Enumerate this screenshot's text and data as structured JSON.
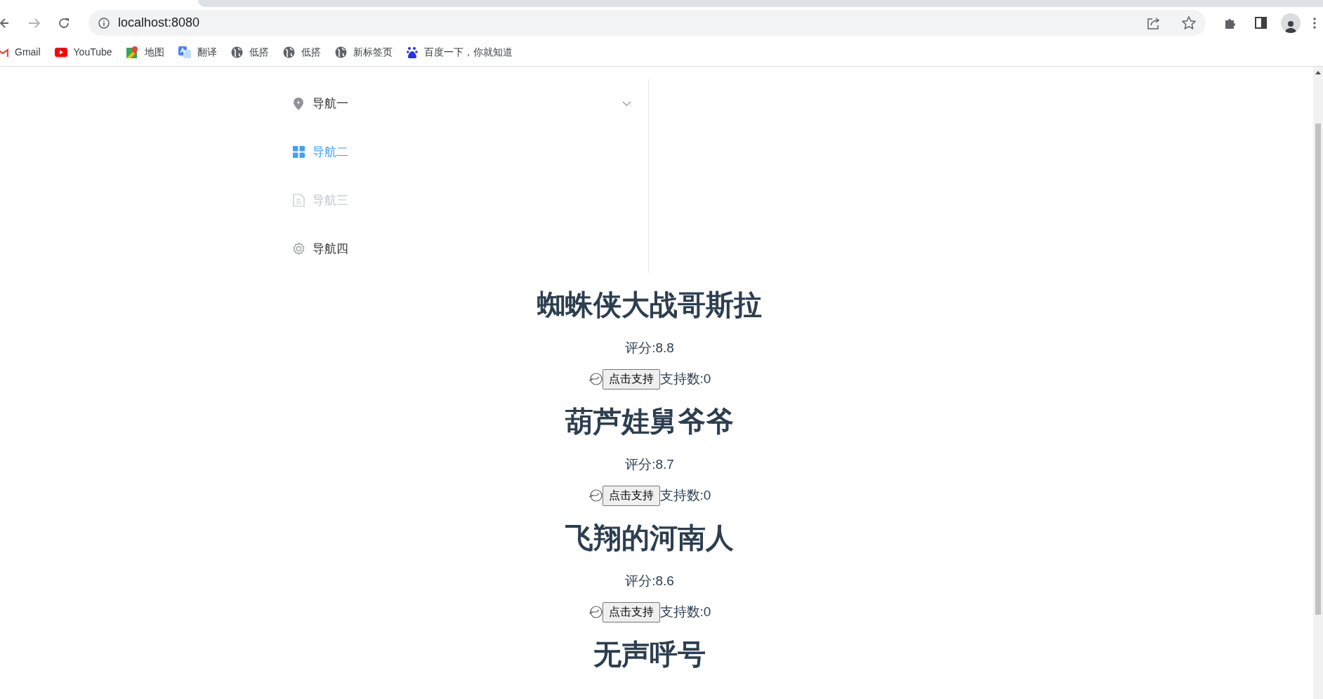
{
  "browser": {
    "url": "localhost:8080",
    "bookmarks": [
      {
        "label": "Gmail",
        "kind": "gmail"
      },
      {
        "label": "YouTube",
        "kind": "youtube"
      },
      {
        "label": "地图",
        "kind": "maps"
      },
      {
        "label": "翻译",
        "kind": "translate"
      },
      {
        "label": "低搭",
        "kind": "globe"
      },
      {
        "label": "低搭",
        "kind": "globe"
      },
      {
        "label": "新标签页",
        "kind": "globe"
      },
      {
        "label": "百度一下，你就知道",
        "kind": "paw"
      }
    ]
  },
  "menu": {
    "items": [
      {
        "label": "导航一",
        "kind": "location",
        "selected": false,
        "disabled": false,
        "has_submenu": true
      },
      {
        "label": "导航二",
        "kind": "grid",
        "selected": true,
        "disabled": false,
        "has_submenu": false
      },
      {
        "label": "导航三",
        "kind": "document",
        "selected": false,
        "disabled": true,
        "has_submenu": false
      },
      {
        "label": "导航四",
        "kind": "gear",
        "selected": false,
        "disabled": false,
        "has_submenu": false
      }
    ]
  },
  "movies": [
    {
      "title": "蜘蛛侠大战哥斯拉",
      "rating": "评分:8.8",
      "button": "点击支持",
      "count": "支持数:0"
    },
    {
      "title": "葫芦娃舅爷爷",
      "rating": "评分:8.7",
      "button": "点击支持",
      "count": "支持数:0"
    },
    {
      "title": "飞翔的河南人",
      "rating": "评分:8.6",
      "button": "点击支持",
      "count": "支持数:0"
    },
    {
      "title": "无声呼号"
    }
  ]
}
